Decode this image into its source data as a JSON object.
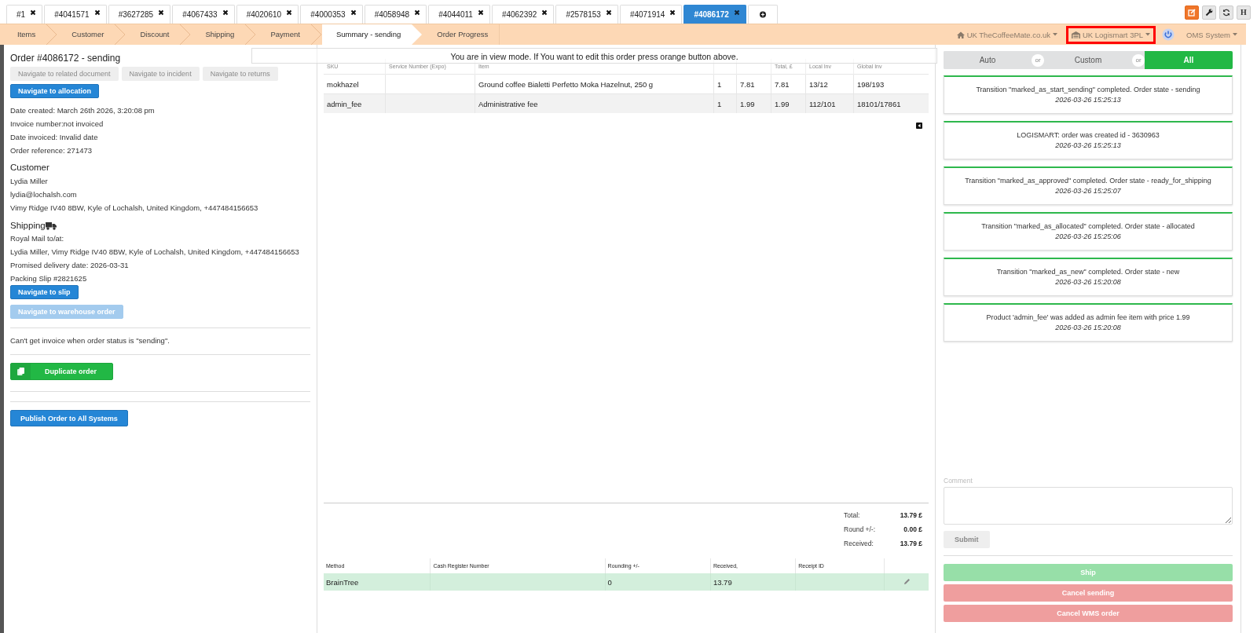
{
  "tabs": [
    {
      "label": "#1",
      "selected": false
    },
    {
      "label": "#4041571",
      "selected": false
    },
    {
      "label": "#3627285",
      "selected": false
    },
    {
      "label": "#4067433",
      "selected": false
    },
    {
      "label": "#4020610",
      "selected": false
    },
    {
      "label": "#4000353",
      "selected": false
    },
    {
      "label": "#4058948",
      "selected": false
    },
    {
      "label": "#4044011",
      "selected": false
    },
    {
      "label": "#4062392",
      "selected": false
    },
    {
      "label": "#2578153",
      "selected": false
    },
    {
      "label": "#4071914",
      "selected": false
    },
    {
      "label": "#4086172",
      "selected": true
    }
  ],
  "toolbar_buttons": [
    {
      "kind": "edit"
    },
    {
      "kind": "wrench"
    },
    {
      "kind": "refresh"
    },
    {
      "kind": "text",
      "label": "H"
    }
  ],
  "breadcrumbs": [
    {
      "label": "Items",
      "selected": false
    },
    {
      "label": "Customer",
      "selected": false
    },
    {
      "label": "Discount",
      "selected": false
    },
    {
      "label": "Shipping",
      "selected": false
    },
    {
      "label": "Payment",
      "selected": false
    },
    {
      "label": "Summary - sending",
      "selected": true
    },
    {
      "label": "Order Progress",
      "selected": false
    }
  ],
  "context_menus": [
    {
      "kind": "home",
      "label": "UK TheCoffeeMate.co.uk",
      "highlighted": false
    },
    {
      "kind": "warehouse",
      "label": "UK Logismart 3PL",
      "highlighted": true
    },
    {
      "kind": "power"
    },
    {
      "kind": "plain",
      "label": "OMS System",
      "highlighted": false
    }
  ],
  "view_mode_banner": "You are in view mode. If You want to edit this order press orange button above.",
  "order": {
    "title": "Order #4086172 - sending",
    "nav_buttons": [
      {
        "label": "Navigate to related document",
        "disabled": true
      },
      {
        "label": "Navigate to incident",
        "disabled": true
      },
      {
        "label": "Navigate to returns",
        "disabled": true
      }
    ],
    "allocation_button": {
      "label": "Navigate to allocation",
      "disabled": false
    },
    "details": [
      "Date created: March 26th 2026, 3:20:08 pm",
      "Invoice number:not invoiced",
      "Date invoiced: Invalid date",
      "Order reference: 271473"
    ],
    "customer": {
      "heading": "Customer",
      "lines": [
        "Lydia Miller",
        "lydia@lochalsh.com",
        "Vimy Ridge IV40 8BW, Kyle of Lochalsh, United Kingdom, +447484156653"
      ]
    },
    "shipping": {
      "heading": "Shipping",
      "lines": [
        "Royal Mail to/at:",
        "Lydia Miller, Vimy Ridge IV40 8BW, Kyle of Lochalsh, United Kingdom, +447484156653",
        "Promised delivery date: 2026-03-31",
        "Packing Slip #2821625"
      ],
      "buttons": [
        {
          "label": "Navigate to slip",
          "disabled": false
        },
        {
          "label": "Navigate to warehouse order",
          "disabled": true
        }
      ]
    },
    "invoice_note": "Can't get invoice when order status is \"sending\".",
    "duplicate_button": "Duplicate order",
    "publish_button": "Publish Order to All Systems"
  },
  "items_table": {
    "columns": [
      "SKU",
      "Service Number (Expo)",
      "Item",
      null,
      null,
      "Total, £",
      "Local Inv",
      "Global Inv"
    ],
    "rows": [
      {
        "cells": [
          "mokhazel",
          null,
          "Ground coffee Bialetti Perfetto Moka Hazelnut, 250 g",
          "1",
          "7.81",
          "7.81",
          "13/12",
          "198/193"
        ]
      },
      {
        "cells": [
          "admin_fee",
          null,
          "Administrative fee",
          "1",
          "1.99",
          "1.99",
          "112/101",
          "18101/17861"
        ]
      }
    ]
  },
  "totals": [
    {
      "label": "Total:",
      "value": "13.79 £"
    },
    {
      "label": "Round +/-:",
      "value": "0.00 £"
    },
    {
      "label": "Received:",
      "value": "13.79 £"
    }
  ],
  "payments_table": {
    "columns": [
      "Method",
      "Cash Register Number",
      "Rounding +/-",
      "Received,",
      "Receipt ID"
    ],
    "rows": [
      {
        "cells": [
          "BrainTree",
          null,
          "0",
          "13.79",
          null
        ]
      }
    ]
  },
  "log_filter": [
    {
      "label": "Auto",
      "selected": false
    },
    {
      "label": "Custom",
      "selected": false,
      "separator": "or"
    },
    {
      "label": "All",
      "selected": true,
      "separator": "or"
    }
  ],
  "log": [
    {
      "message": "Transition \"marked_as_start_sending\" completed. Order state - sending",
      "time": "2026-03-26 15:25:13"
    },
    {
      "message": "LOGISMART: order was created id - 3630963",
      "time": "2026-03-26 15:25:13"
    },
    {
      "message": "Transition \"marked_as_approved\" completed. Order state - ready_for_shipping",
      "time": "2026-03-26 15:25:07"
    },
    {
      "message": "Transition \"marked_as_allocated\" completed. Order state - allocated",
      "time": "2026-03-26 15:25:06"
    },
    {
      "message": "Transition \"marked_as_new\" completed. Order state - new",
      "time": "2026-03-26 15:20:08"
    },
    {
      "message": "Product 'admin_fee' was added as admin fee item with price 1.99",
      "time": "2026-03-26 15:20:08"
    }
  ],
  "comment": {
    "label": "Comment"
  },
  "submit_button": {
    "label": "Submit",
    "disabled": true
  },
  "actions": [
    {
      "kind": "ship",
      "label": "Ship"
    },
    {
      "kind": "cancel",
      "label": "Cancel sending"
    },
    {
      "kind": "cancel",
      "label": "Cancel WMS order"
    }
  ]
}
